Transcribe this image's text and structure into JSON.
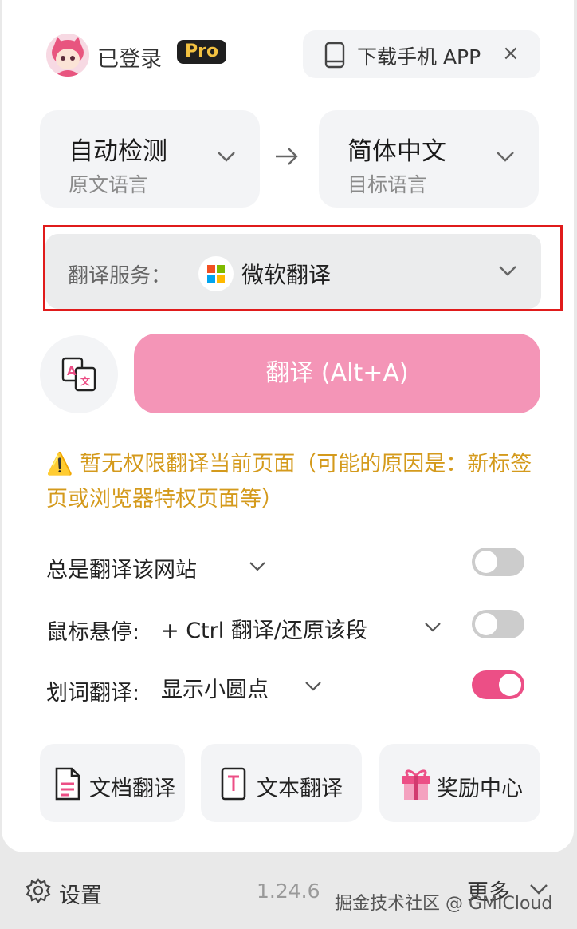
{
  "header": {
    "login_status": "已登录",
    "pro_badge": "Pro",
    "download_app_label": "下载手机 APP",
    "close_symbol": "×"
  },
  "languages": {
    "source": {
      "value": "自动检测",
      "caption": "原文语言"
    },
    "target": {
      "value": "简体中文",
      "caption": "目标语言"
    }
  },
  "service": {
    "label": "翻译服务：",
    "name": "微软翻译"
  },
  "translate_button": "翻译 (Alt+A)",
  "warning": "⚠️ 暂无权限翻译当前页面（可能的原因是：新标签页或浏览器特权页面等）",
  "settings": {
    "always_translate": {
      "label": "总是翻译该网站",
      "enabled": false
    },
    "hover": {
      "label": "鼠标悬停:",
      "value": "+ Ctrl 翻译/还原该段",
      "enabled": false
    },
    "selection": {
      "label": "划词翻译:",
      "value": "显示小圆点",
      "enabled": true
    }
  },
  "tiles": [
    {
      "label": "文档翻译",
      "icon": "document-icon"
    },
    {
      "label": "文本翻译",
      "icon": "text-icon"
    },
    {
      "label": "奖励中心",
      "icon": "gift-icon"
    }
  ],
  "footer": {
    "settings_label": "设置",
    "version": "1.24.6",
    "more_label": "更多"
  },
  "watermark": "掘金技术社区 @ GMICloud",
  "colors": {
    "accent_pink": "#ec4f86",
    "button_pink": "#f495b7",
    "warning_orange": "#d49a1c",
    "highlight_red": "#e01b1b"
  }
}
